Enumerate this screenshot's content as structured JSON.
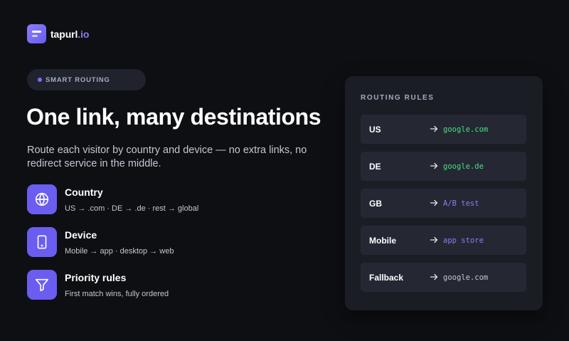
{
  "brand": {
    "name": "tapurl",
    "tld": ".io",
    "accent": "#8b7cf6"
  },
  "badge": {
    "label": "SMART ROUTING"
  },
  "hero": {
    "headline": "One link, many destinations",
    "subtitle": "Route each visitor by country and device — no extra links, no redirect service in the middle."
  },
  "features": [
    {
      "title": "Country",
      "description": "US → .com · DE → .de · rest → global",
      "icon": "globe-icon"
    },
    {
      "title": "Device",
      "description": "Mobile → app · desktop → web",
      "icon": "smartphone-icon"
    },
    {
      "title": "Priority rules",
      "description": "First match wins, fully ordered",
      "icon": "filter-icon"
    }
  ],
  "routing": {
    "title": "ROUTING RULES",
    "rules": [
      {
        "key": "US",
        "target": "google.com",
        "color": "#4ade80"
      },
      {
        "key": "DE",
        "target": "google.de",
        "color": "#4ade80"
      },
      {
        "key": "GB",
        "target": "A/B test",
        "color": "#8b7cf6"
      },
      {
        "key": "Mobile",
        "target": "app store",
        "color": "#8b7cf6"
      },
      {
        "key": "Fallback",
        "target": "google.com",
        "color": "#c3c7d2"
      }
    ]
  }
}
